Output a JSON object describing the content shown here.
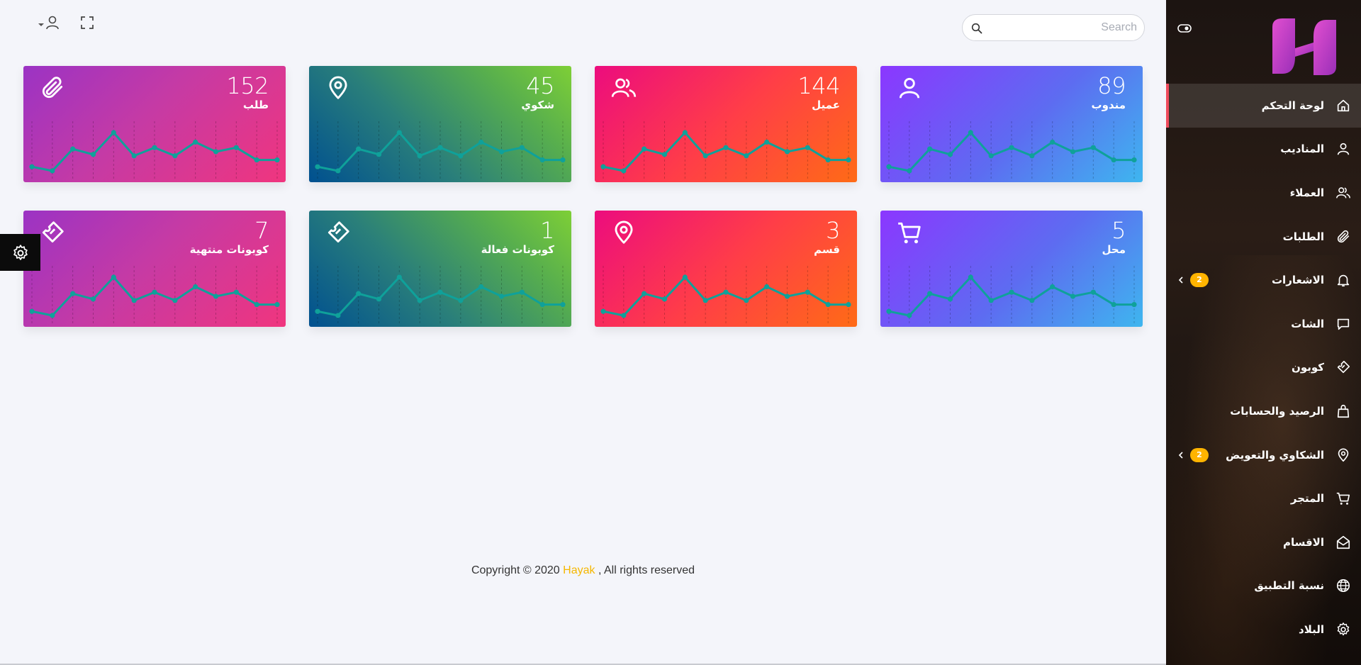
{
  "topbar": {
    "search_placeholder": "Search",
    "icons": [
      "search-icon",
      "user-icon",
      "fullscreen-icon"
    ]
  },
  "sidebar": {
    "toggle_icon": "toggle-icon",
    "logo": "hayak-logo",
    "items": [
      {
        "label": "لوحة التحكم",
        "icon": "home-icon",
        "active": true
      },
      {
        "label": "المناديب",
        "icon": "user-icon"
      },
      {
        "label": "العملاء",
        "icon": "users-icon"
      },
      {
        "label": "الطلبات",
        "icon": "paperclip-icon"
      },
      {
        "label": "الاشعارات",
        "icon": "bell-icon",
        "badge": "2"
      },
      {
        "label": "الشات",
        "icon": "chat-icon"
      },
      {
        "label": "كوبون",
        "icon": "coupon-icon"
      },
      {
        "label": "الرصيد والحسابات",
        "icon": "bag-icon"
      },
      {
        "label": "الشكاوي والتعويض",
        "icon": "map-pin-icon",
        "badge": "2"
      },
      {
        "label": "المتجر",
        "icon": "cart-icon"
      },
      {
        "label": "الاقسام",
        "icon": "envelope-open-icon"
      },
      {
        "label": "نسبة التطبيق",
        "icon": "globe-icon"
      },
      {
        "label": "البلاد",
        "icon": "gear-icon"
      }
    ]
  },
  "cards": [
    {
      "value": "89",
      "label": "مندوب",
      "icon": "user-icon",
      "color": "#5d6cf1"
    },
    {
      "value": "144",
      "label": "عميل",
      "icon": "users-icon",
      "color": "#ff3d48"
    },
    {
      "value": "45",
      "label": "شكوي",
      "icon": "map-pin-icon",
      "color": "#2a7f7a"
    },
    {
      "value": "152",
      "label": "طلب",
      "icon": "paperclip-icon",
      "color": "#c53aa5"
    },
    {
      "value": "5",
      "label": "محل",
      "icon": "cart-icon",
      "color": "#5d6cf1"
    },
    {
      "value": "3",
      "label": "قسم",
      "icon": "map-pin-icon",
      "color": "#ff3d48"
    },
    {
      "value": "1",
      "label": "كوبونات فعالة",
      "icon": "coupon-icon",
      "color": "#2a7f7a"
    },
    {
      "value": "7",
      "label": "كوبونات منتهية",
      "icon": "coupon-icon",
      "color": "#c53aa5"
    }
  ],
  "sparkline": {
    "values": [
      5,
      2,
      18,
      14,
      30,
      13,
      19,
      13,
      23,
      16,
      19,
      10,
      10
    ],
    "color": "#0fa19a"
  },
  "footer": {
    "prefix": "Copyright © 2020",
    "brand": "Hayak",
    "suffix": ", All rights reserved",
    "brand_color": "#f5b700"
  },
  "settings_icon": "gear-icon"
}
